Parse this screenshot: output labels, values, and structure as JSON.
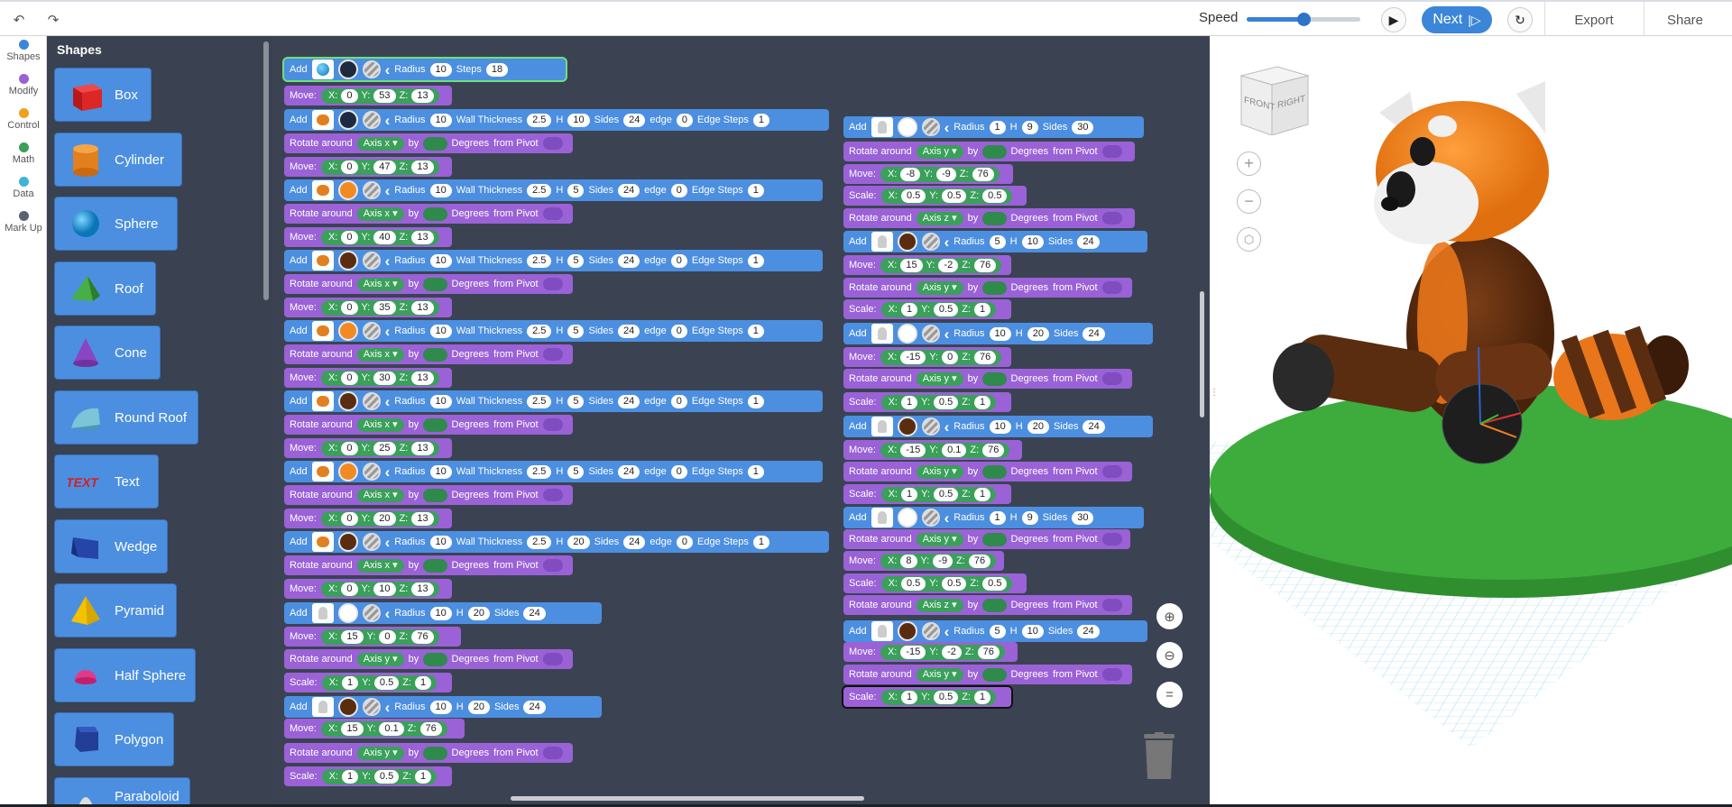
{
  "toolbar": {
    "undo_icon": "undo-arrow-icon",
    "redo_icon": "redo-arrow-icon",
    "speed_label": "Speed",
    "speed_value": 0.5,
    "play_icon": "play-icon",
    "next_label": "Next",
    "next_icon": "step-icon",
    "reset_icon": "reset-icon",
    "export_label": "Export",
    "share_label": "Share"
  },
  "categories": [
    {
      "label": "Shapes",
      "color": "#3b86d8"
    },
    {
      "label": "Modify",
      "color": "#9a62d6"
    },
    {
      "label": "Control",
      "color": "#f0a21f"
    },
    {
      "label": "Math",
      "color": "#3aa05a"
    },
    {
      "label": "Data",
      "color": "#3fb3d9"
    },
    {
      "label": "Mark Up",
      "color": "#5a6170"
    }
  ],
  "flyout": {
    "title": "Shapes",
    "items": [
      "Box",
      "Cylinder",
      "Sphere",
      "Roof",
      "Cone",
      "Round Roof",
      "Text",
      "Wedge",
      "Pyramid",
      "Half Sphere",
      "Polygon",
      "Paraboloid"
    ]
  },
  "words": {
    "add": "Add",
    "radius": "Radius",
    "steps": "Steps",
    "wall": "Wall Thickness",
    "h": "H",
    "sides": "Sides",
    "edge": "edge",
    "edge_steps": "Edge Steps",
    "move": "Move:",
    "x": "X:",
    "y": "Y:",
    "z": "Z:",
    "rotate": "Rotate around",
    "by": "by",
    "degrees": "Degrees",
    "from_pivot": "from Pivot",
    "scale": "Scale:",
    "axis_x": "Axis x",
    "axis_y": "Axis y",
    "axis_z": "Axis z"
  },
  "blocks": {
    "l0": {
      "radius": "10",
      "steps": "18"
    },
    "l1": {
      "x": "0",
      "y": "53",
      "z": "13"
    },
    "l2": {
      "radius": "10",
      "wall": "2.5",
      "h": "10",
      "sides": "24",
      "edge": "0",
      "esteps": "1"
    },
    "l4": {
      "x": "0",
      "y": "47",
      "z": "13"
    },
    "l5": {
      "radius": "10",
      "wall": "2.5",
      "h": "5",
      "sides": "24",
      "edge": "0",
      "esteps": "1"
    },
    "l7": {
      "x": "0",
      "y": "40",
      "z": "13"
    },
    "l8": {
      "radius": "10",
      "wall": "2.5",
      "h": "5",
      "sides": "24",
      "edge": "0",
      "esteps": "1"
    },
    "l10": {
      "x": "0",
      "y": "35",
      "z": "13"
    },
    "l11": {
      "radius": "10",
      "wall": "2.5",
      "h": "5",
      "sides": "24",
      "edge": "0",
      "esteps": "1"
    },
    "l13": {
      "x": "0",
      "y": "30",
      "z": "13"
    },
    "l14": {
      "radius": "10",
      "wall": "2.5",
      "h": "5",
      "sides": "24",
      "edge": "0",
      "esteps": "1"
    },
    "l16": {
      "x": "0",
      "y": "25",
      "z": "13"
    },
    "l17": {
      "radius": "10",
      "wall": "2.5",
      "h": "5",
      "sides": "24",
      "edge": "0",
      "esteps": "1"
    },
    "l19": {
      "x": "0",
      "y": "20",
      "z": "13"
    },
    "l20": {
      "radius": "10",
      "wall": "2.5",
      "h": "20",
      "sides": "24",
      "edge": "0",
      "esteps": "1"
    },
    "l22": {
      "x": "0",
      "y": "10",
      "z": "13"
    },
    "l23": {
      "radius": "10",
      "h": "20",
      "sides": "24"
    },
    "l24": {
      "x": "15",
      "y": "0",
      "z": "76"
    },
    "l26": {
      "x": "1",
      "y": "0.5",
      "z": "1"
    },
    "l27": {
      "radius": "10",
      "h": "20",
      "sides": "24"
    },
    "l28": {
      "x": "15",
      "y": "0.1",
      "z": "76"
    },
    "l30": {
      "x": "1",
      "y": "0.5",
      "z": "1"
    },
    "r0": {
      "radius": "1",
      "h": "9",
      "sides": "30"
    },
    "r2": {
      "x": "-8",
      "y": "-9",
      "z": "76"
    },
    "r3": {
      "x": "0.5",
      "y": "0.5",
      "z": "0.5"
    },
    "r5": {
      "radius": "5",
      "h": "10",
      "sides": "24"
    },
    "r6": {
      "x": "15",
      "y": "-2",
      "z": "76"
    },
    "r8": {
      "x": "1",
      "y": "0.5",
      "z": "1"
    },
    "r9": {
      "radius": "10",
      "h": "20",
      "sides": "24"
    },
    "r10": {
      "x": "-15",
      "y": "0",
      "z": "76"
    },
    "r12": {
      "x": "1",
      "y": "0.5",
      "z": "1"
    },
    "r13": {
      "radius": "10",
      "h": "20",
      "sides": "24"
    },
    "r14": {
      "x": "-15",
      "y": "0.1",
      "z": "76"
    },
    "r16": {
      "x": "1",
      "y": "0.5",
      "z": "1"
    },
    "r17": {
      "radius": "1",
      "h": "9",
      "sides": "30"
    },
    "r19": {
      "x": "8",
      "y": "-9",
      "z": "76"
    },
    "r20": {
      "x": "0.5",
      "y": "0.5",
      "z": "0.5"
    },
    "r22": {
      "radius": "5",
      "h": "10",
      "sides": "24"
    },
    "r23": {
      "x": "-15",
      "y": "-2",
      "z": "76"
    },
    "r25": {
      "x": "1",
      "y": "0.5",
      "z": "1"
    }
  },
  "viewer": {
    "cube_front": "FRONT",
    "cube_right": "RIGHT",
    "zoom_in_icon": "plus-icon",
    "zoom_out_icon": "minus-icon",
    "home_icon": "cube-icon"
  },
  "colors": {
    "blue_block": "#4c8fe0",
    "purple_block": "#9a62d6",
    "green_input": "#3aa05a",
    "workspace": "#3b4353",
    "orange": "#f28a24",
    "dark_brown": "#5a2d10",
    "ground": "#3dac3d"
  }
}
